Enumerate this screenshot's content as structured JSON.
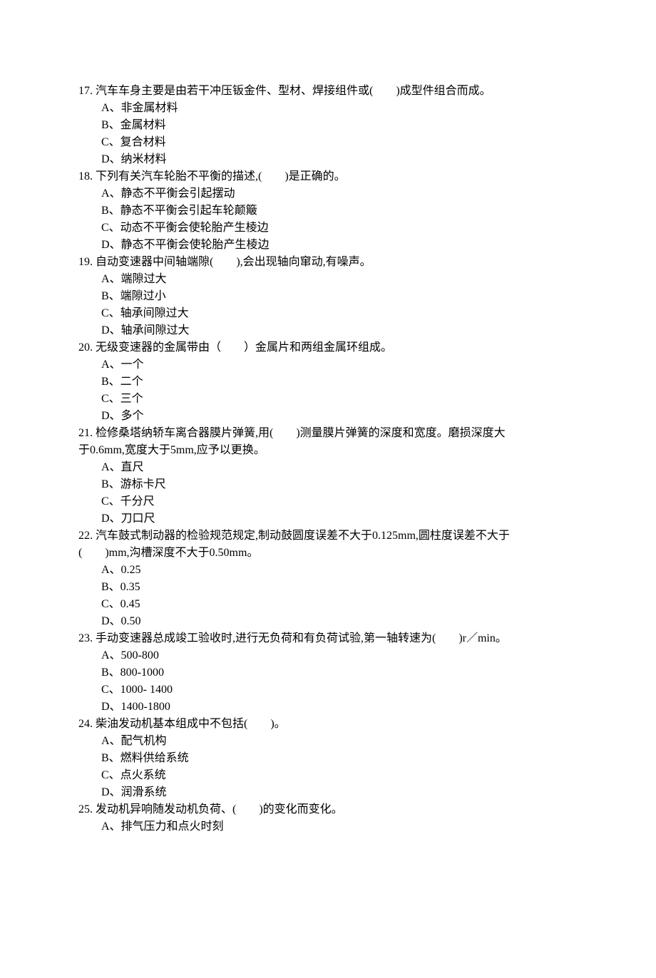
{
  "questions": [
    {
      "num": "17.",
      "stem": "汽车车身主要是由若干冲压钣金件、型材、焊接组件或(　　)成型件组合而成。",
      "options": [
        "A、非金属材料",
        "B、金属材料",
        "C、复合材料",
        "D、纳米材料"
      ]
    },
    {
      "num": "18.",
      "stem": "下列有关汽车轮胎不平衡的描述,(　　)是正确的。",
      "options": [
        "A、静态不平衡会引起摆动",
        "B、静态不平衡会引起车轮颠簸",
        "C、动态不平衡会使轮胎产生棱边",
        "D、静态不平衡会使轮胎产生棱边"
      ]
    },
    {
      "num": "19.",
      "stem": "自动变速器中间轴端隙(　　),会出现轴向窜动,有噪声。",
      "options": [
        "A、端隙过大",
        "B、端隙过小",
        "C、轴承间隙过大",
        "D、轴承间隙过大"
      ]
    },
    {
      "num": "20.",
      "stem": "无级变速器的金属带由（　　）金属片和两组金属环组成。",
      "options": [
        "A、一个",
        "B、二个",
        "C、三个",
        "D、多个"
      ]
    },
    {
      "num": "21.",
      "stem": "检修桑塔纳轿车离合器膜片弹簧,用(　　)测量膜片弹簧的深度和宽度。磨损深度大",
      "stem_cont": "于0.6mm,宽度大于5mm,应予以更换。",
      "options": [
        "A、直尺",
        "B、游标卡尺",
        "C、千分尺",
        "D、刀口尺"
      ]
    },
    {
      "num": "22.",
      "stem": "汽车鼓式制动器的检验规范规定,制动鼓圆度误差不大于0.125mm,圆柱度误差不大于",
      "stem_cont": "(　　)mm,沟槽深度不大于0.50mm。",
      "options": [
        "A、0.25",
        "B、0.35",
        "C、0.45",
        "D、0.50"
      ]
    },
    {
      "num": "23.",
      "stem": "手动变速器总成竣工验收时,进行无负荷和有负荷试验,第一轴转速为(　　)r／min。",
      "options": [
        "A、500-800",
        "B、800-1000",
        "C、1000- 1400",
        "D、1400-1800"
      ]
    },
    {
      "num": "24.",
      "stem": "柴油发动机基本组成中不包括(　　)。",
      "options": [
        "A、配气机构",
        "B、燃料供给系统",
        "C、点火系统",
        "D、润滑系统"
      ]
    },
    {
      "num": "25.",
      "stem": "发动机异响随发动机负荷、(　　)的变化而变化。",
      "options": [
        "A、排气压力和点火时刻"
      ]
    }
  ]
}
